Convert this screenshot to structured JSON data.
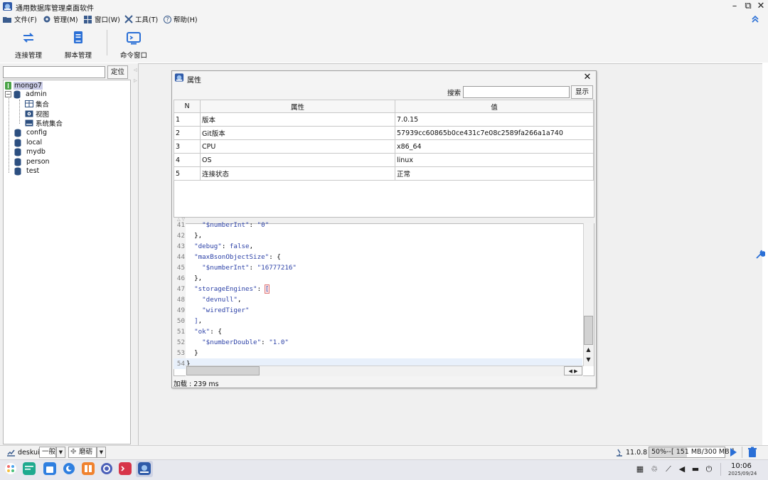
{
  "window": {
    "title": "通用数据库管理桌面软件",
    "controls": {
      "minimize": "–",
      "restore": "⧉",
      "close": "✕"
    }
  },
  "menu": [
    {
      "label": "文件(F)",
      "icon": "folder-icon"
    },
    {
      "label": "管理(M)",
      "icon": "gear-icon"
    },
    {
      "label": "窗口(W)",
      "icon": "windows-icon"
    },
    {
      "label": "工具(T)",
      "icon": "tools-icon"
    },
    {
      "label": "帮助(H)",
      "icon": "help-icon",
      "glyph": "?"
    }
  ],
  "toolbar": {
    "connect": "连接管理",
    "script": "脚本管理",
    "command": "命令窗口"
  },
  "tree": {
    "search_value": "",
    "locate_label": "定位",
    "root": "mongo7",
    "expanded_toggle": "−",
    "nodes": {
      "admin": "admin",
      "collections": "集合",
      "views": "视图",
      "system_collections": "系统集合",
      "config": "config",
      "local": "local",
      "mydb": "mydb",
      "person": "person",
      "test": "test"
    }
  },
  "dialog": {
    "title": "属性",
    "close": "✕",
    "search_label": "搜索",
    "search_value": "",
    "show_label": "显示",
    "columns": {
      "n": "N",
      "prop": "属性",
      "val": "值"
    },
    "rows": [
      {
        "n": "1",
        "prop": "版本",
        "val": "7.0.15"
      },
      {
        "n": "2",
        "prop": "Git版本",
        "val": "57939cc60865b0ce431c7e08c2589fa266a1a740"
      },
      {
        "n": "3",
        "prop": "CPU",
        "val": "x86_64"
      },
      {
        "n": "4",
        "prop": "OS",
        "val": "linux"
      },
      {
        "n": "5",
        "prop": "连接状态",
        "val": "正常"
      }
    ],
    "code_lines": [
      {
        "num": "41",
        "text": "    \"$numberInt\": \"0\""
      },
      {
        "num": "42",
        "text": "  },"
      },
      {
        "num": "43",
        "text": "  \"debug\": false,"
      },
      {
        "num": "44",
        "text": "  \"maxBsonObjectSize\": {"
      },
      {
        "num": "45",
        "text": "    \"$numberInt\": \"16777216\""
      },
      {
        "num": "46",
        "text": "  },"
      },
      {
        "num": "47",
        "text": "  \"storageEngines\": ["
      },
      {
        "num": "48",
        "text": "    \"devnull\","
      },
      {
        "num": "49",
        "text": "    \"wiredTiger\""
      },
      {
        "num": "50",
        "text": "  ],"
      },
      {
        "num": "51",
        "text": "  \"ok\": {"
      },
      {
        "num": "52",
        "text": "    \"$numberDouble\": \"1.0\""
      },
      {
        "num": "53",
        "text": "  }"
      },
      {
        "num": "54",
        "text": "}"
      }
    ],
    "load_status": "加载 : 239 ms"
  },
  "statusbar": {
    "user": "deskui",
    "level": "一般",
    "theme": "磨砺",
    "version": "11.0.8",
    "memory": "50%--[ 151 MB/300 MB ]"
  },
  "taskbar": {
    "time": "10:06",
    "date": "2025/09/24"
  },
  "colors": {
    "accent": "#2a6fd6",
    "key_blue": "#2e43a8",
    "selected_root": "#c9cbe6",
    "mongo_green": "#4aa347"
  }
}
